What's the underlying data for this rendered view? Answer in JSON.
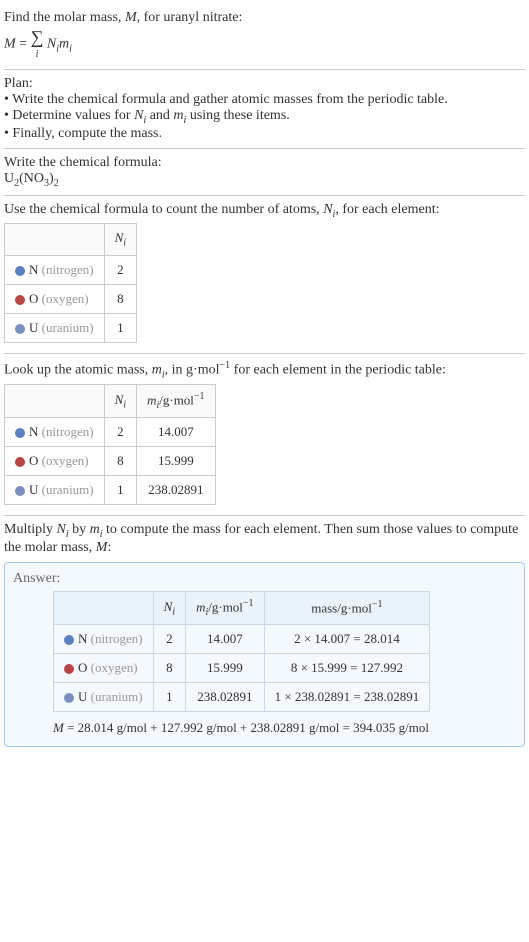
{
  "intro": {
    "line1_a": "Find the molar mass, ",
    "line1_M": "M",
    "line1_b": ", for uranyl nitrate:",
    "formula_M": "M",
    "formula_eq": " = ",
    "formula_sum": "∑",
    "formula_sum_i": "i",
    "formula_Ni": "N",
    "formula_Ni_sub": "i",
    "formula_mi": "m",
    "formula_mi_sub": "i"
  },
  "plan": {
    "title": "Plan:",
    "b1_a": "• Write the chemical formula and gather atomic masses from the periodic table.",
    "b2_a": "• Determine values for ",
    "b2_N": "N",
    "b2_Nsub": "i",
    "b2_b": " and ",
    "b2_m": "m",
    "b2_msub": "i",
    "b2_c": " using these items.",
    "b3": "• Finally, compute the mass."
  },
  "formula_section": {
    "title": "Write the chemical formula:",
    "chem_U": "U",
    "chem_U_sub": "2",
    "chem_open": "(NO",
    "chem_NO_sub": "3",
    "chem_close": ")",
    "chem_close_sub": "2"
  },
  "count_section": {
    "title_a": "Use the chemical formula to count the number of atoms, ",
    "title_N": "N",
    "title_Nsub": "i",
    "title_b": ", for each element:",
    "header_N": "N",
    "header_Nsub": "i",
    "rows": [
      {
        "sym": "N",
        "name": "(nitrogen)",
        "n": "2"
      },
      {
        "sym": "O",
        "name": "(oxygen)",
        "n": "8"
      },
      {
        "sym": "U",
        "name": "(uranium)",
        "n": "1"
      }
    ]
  },
  "mass_section": {
    "title_a": "Look up the atomic mass, ",
    "title_m": "m",
    "title_msub": "i",
    "title_b": ", in g·mol",
    "title_sup": "−1",
    "title_c": " for each element in the periodic table:",
    "header_N": "N",
    "header_Nsub": "i",
    "header_m": "m",
    "header_msub": "i",
    "header_unit": "/g·mol",
    "header_unit_sup": "−1",
    "rows": [
      {
        "sym": "N",
        "name": "(nitrogen)",
        "n": "2",
        "m": "14.007"
      },
      {
        "sym": "O",
        "name": "(oxygen)",
        "n": "8",
        "m": "15.999"
      },
      {
        "sym": "U",
        "name": "(uranium)",
        "n": "1",
        "m": "238.02891"
      }
    ]
  },
  "multiply_section": {
    "text_a": "Multiply ",
    "text_N": "N",
    "text_Nsub": "i",
    "text_b": " by ",
    "text_m": "m",
    "text_msub": "i",
    "text_c": " to compute the mass for each element. Then sum those values to compute the molar mass, ",
    "text_M": "M",
    "text_d": ":"
  },
  "answer": {
    "label": "Answer:",
    "header_N": "N",
    "header_Nsub": "i",
    "header_m": "m",
    "header_msub": "i",
    "header_munit": "/g·mol",
    "header_munit_sup": "−1",
    "header_mass": "mass/g·mol",
    "header_mass_sup": "−1",
    "rows": [
      {
        "sym": "N",
        "name": "(nitrogen)",
        "n": "2",
        "m": "14.007",
        "calc": "2 × 14.007 = 28.014"
      },
      {
        "sym": "O",
        "name": "(oxygen)",
        "n": "8",
        "m": "15.999",
        "calc": "8 × 15.999 = 127.992"
      },
      {
        "sym": "U",
        "name": "(uranium)",
        "n": "1",
        "m": "238.02891",
        "calc": "1 × 238.02891 = 238.02891"
      }
    ],
    "final_M": "M",
    "final_text": " = 28.014 g/mol + 127.992 g/mol + 238.02891 g/mol = 394.035 g/mol"
  }
}
